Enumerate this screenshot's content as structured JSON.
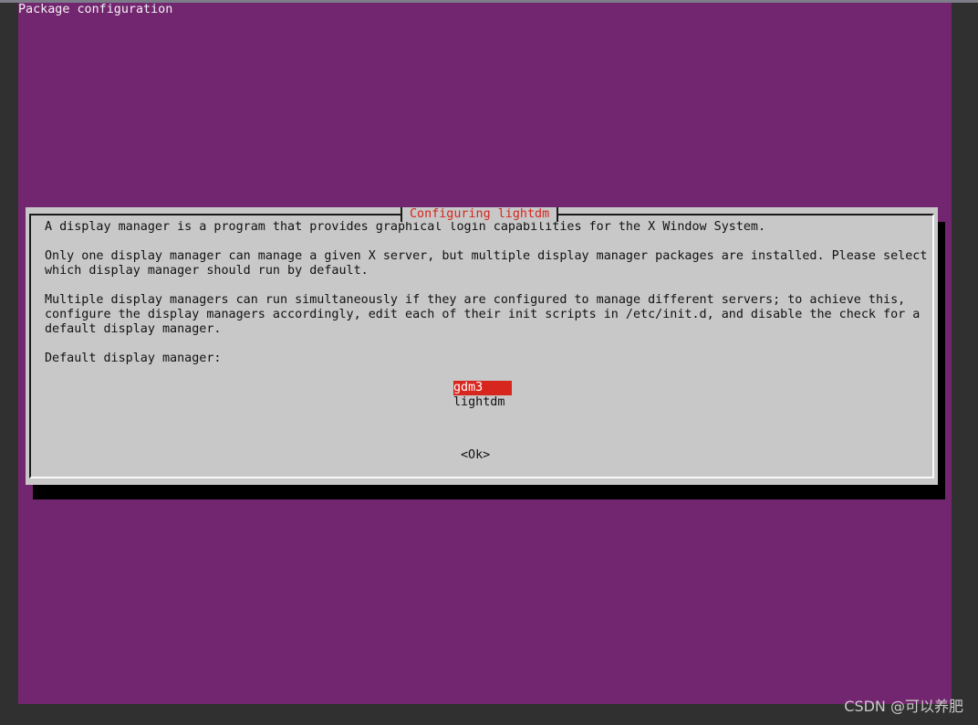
{
  "backtitle": "Package configuration",
  "dialog": {
    "title": "Configuring lightdm",
    "lines": [
      "A display manager is a program that provides graphical login capabilities for the X Window System.",
      "Only one display manager can manage a given X server, but multiple display manager packages are installed. Please select",
      "which display manager should run by default.",
      "Multiple display managers can run simultaneously if they are configured to manage different servers; to achieve this,",
      "configure the display managers accordingly, edit each of their init scripts in /etc/init.d, and disable the check for a",
      "default display manager.",
      "Default display manager:"
    ],
    "options": [
      "gdm3",
      "lightdm"
    ],
    "selected_option": "gdm3",
    "ok_label": "<Ok>"
  },
  "watermark": "CSDN @可以养肥",
  "colors": {
    "screen_bg": "#732670",
    "dialog_bg": "#c8c8c8",
    "title_color": "#d7261e",
    "selection_bg": "#d7261e"
  }
}
